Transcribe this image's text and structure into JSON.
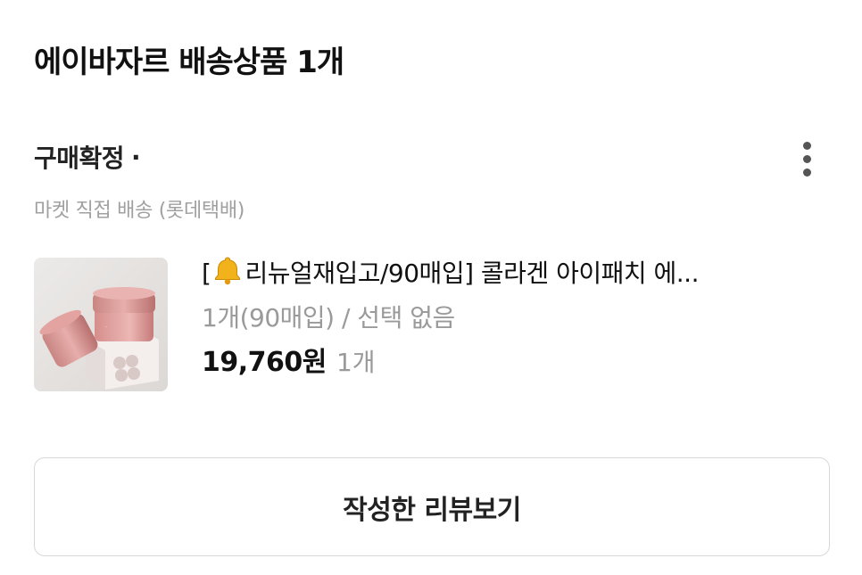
{
  "section": {
    "title": "에이바자르 배송상품 1개"
  },
  "order": {
    "status": "구매확정",
    "status_dot": "·",
    "shipping_info": "마켓 직접 배송 (롯데택배)"
  },
  "product": {
    "name_prefix": "[",
    "name_rest": "리뉴얼재입고/90매입] 콜라겐 아이패치 에...",
    "option": "1개(90매입) / 선택 없음",
    "price": "19,760원",
    "quantity": "1개",
    "thumbnail_icon": "product-jar-image"
  },
  "actions": {
    "review_label": "작성한 리뷰보기",
    "more_icon": "more-vertical-icon"
  },
  "colors": {
    "muted_text": "#9a9a9a",
    "border": "#d8d8d8",
    "thumb_bg": "#e9e7e6",
    "jar_pink": "#d9908f"
  }
}
